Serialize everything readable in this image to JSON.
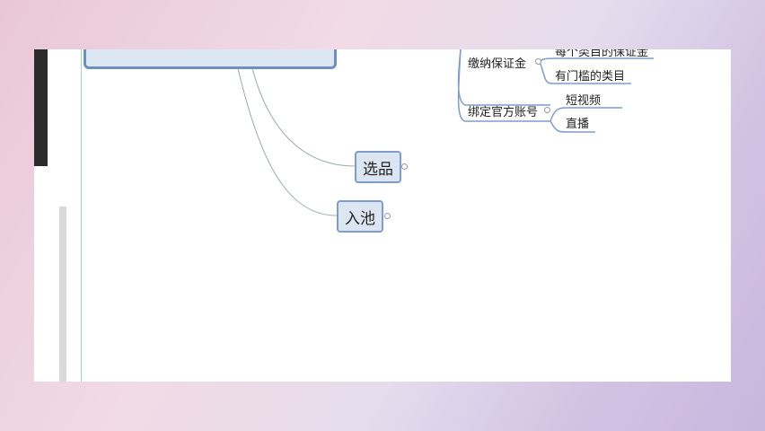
{
  "mindmap": {
    "root": "",
    "branches": [
      {
        "label": "选品"
      },
      {
        "label": "入池"
      }
    ],
    "right": {
      "deposit": {
        "label": "缴纳保证金",
        "children": [
          "每个类目的保证金",
          "有门槛的类目"
        ]
      },
      "account": {
        "label": "绑定官方账号",
        "children": [
          "短视频",
          "直播"
        ]
      }
    }
  }
}
